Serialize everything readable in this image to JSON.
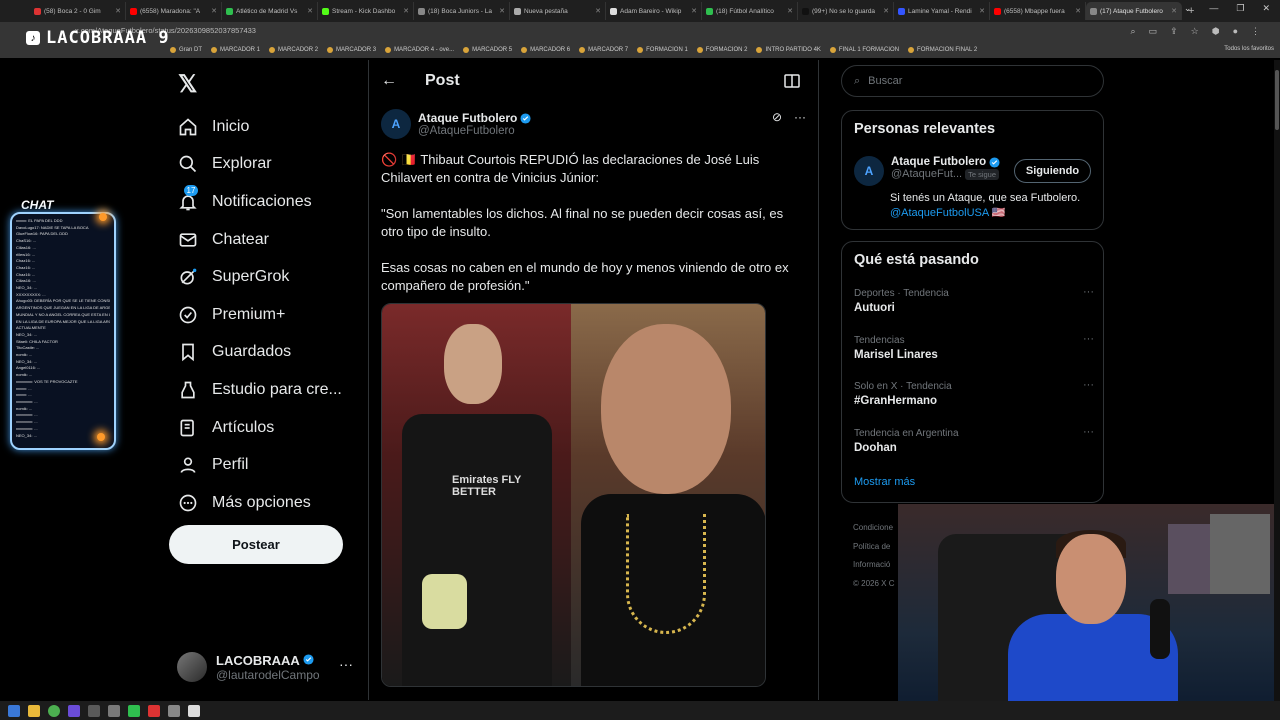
{
  "browser": {
    "tabs": [
      {
        "label": "(58) Boca 2 - 0 Gim",
        "color": "#d33"
      },
      {
        "label": "(6558) Maradona: \"A",
        "color": "#f00"
      },
      {
        "label": "Atlético de Madrid Vs",
        "color": "#2fbf4f"
      },
      {
        "label": "Stream - Kick Dashbo",
        "color": "#53fc18"
      },
      {
        "label": "(18) Boca Juniors - La",
        "color": "#888"
      },
      {
        "label": "Nueva pestaña",
        "color": "#aaa"
      },
      {
        "label": "Adam Bareiro - Wikip",
        "color": "#ddd"
      },
      {
        "label": "(18) Fútbol Analítico",
        "color": "#2fbf4f"
      },
      {
        "label": "(99+) No se lo guarda",
        "color": "#111"
      },
      {
        "label": "Lamine Yamal - Rendi",
        "color": "#3355ff"
      },
      {
        "label": "(6558) Mbappe fuera",
        "color": "#f00"
      },
      {
        "label": "(17) Ataque Futbolero",
        "color": "#888"
      }
    ],
    "url": "x.com/AtaqueFutbolero/status/2026309852037857433",
    "bookmarks": [
      "Gran DT",
      "MARCADOR 1",
      "MARCADOR 2",
      "MARCADOR 3",
      "MARCADOR 4 - ove...",
      "MARCADOR 5",
      "MARCADOR 6",
      "MARCADOR 7",
      "FORMACION 1",
      "FORMACION 2",
      "INTRO PARTIDO 4K",
      "FINAL 1 FORMACION",
      "FORMACION FINAL 2"
    ],
    "bookmarks_right": "Todos los favoritos"
  },
  "overlay": {
    "logo_text": "LACOBRAAA 9",
    "chat_label": "CHAT",
    "chat_lines": [
      "xxxxx: EL PAPA DEL DDD",
      "DavoLugo17: NADIE SE TAPA LA BOCA",
      "GlueFlow16: PAPA DEL DDD",
      "ChaS16: ...",
      "Cilias16: ...",
      "riilew16: ...",
      "Chaz16: ...",
      "Chaz16: ...",
      "Chaz16: ...",
      "Cilias16: ...",
      "NEO_34: ...",
      "XXXXXXXXX: ...",
      "Ahugo03: DEBERÍA POR QUE SE LE TIENE CONSIDERACIÓN A",
      "ARGENTINOS QUE JUEGAN EN LA LIGA DE ARGENTINA PARA EL",
      "MUNDIAL Y NO A ANGEL CORREA QUE ESTA EN UN BUEN NIVEL",
      "EN LA LIGA DE EUROPA MEJOR QUE LA LIGA ARGENTINA",
      "ACTUALMENTE",
      "NEO_34: ...",
      "Sitaeli: CHILA FACTOR",
      "TitoCastle: ...",
      "nomik: ...",
      "NEO_34: ...",
      "Angel0116: ...",
      "nomik: ...",
      "xxxxxxxx: VOS TE PROVOCAZTE",
      "xxxxx: ...",
      "xxxxx: ...",
      "xxxxxxxx: ...",
      "nomik: ...",
      "xxxxxxxx: ...",
      "xxxxxxxx: ...",
      "xxxxxxxx: ...",
      "NEO_34: ..."
    ]
  },
  "sidebar": {
    "items": [
      {
        "label": "Inicio",
        "icon": "home-icon"
      },
      {
        "label": "Explorar",
        "icon": "search-icon"
      },
      {
        "label": "Notificaciones",
        "icon": "bell-icon"
      },
      {
        "label": "Chatear",
        "icon": "mail-icon"
      },
      {
        "label": "SuperGrok",
        "icon": "grok-icon"
      },
      {
        "label": "Premium+",
        "icon": "premium-icon"
      },
      {
        "label": "Guardados",
        "icon": "bookmark-icon"
      },
      {
        "label": "Estudio para cre...",
        "icon": "studio-icon"
      },
      {
        "label": "Artículos",
        "icon": "article-icon"
      },
      {
        "label": "Perfil",
        "icon": "person-icon"
      },
      {
        "label": "Más opciones",
        "icon": "more-circle-icon"
      }
    ],
    "notifications_badge": "17",
    "post_button": "Postear",
    "profile": {
      "name": "LACOBRAAA",
      "handle": "@lautarodelCampo"
    }
  },
  "post": {
    "header_title": "Post",
    "author_name": "Ataque Futbolero",
    "author_handle": "@AtaqueFutbolero",
    "avatar_text": "A",
    "paragraphs": [
      "🚫 🇧🇪 Thibaut Courtois REPUDIÓ las declaraciones de José Luis Chilavert en contra de Vinicius Júnior:",
      "\"Son lamentables los dichos. Al final no se pueden decir cosas así, es otro tipo de insulto.",
      "Esas cosas no caben en el mundo de hoy y menos viniendo de otro ex compañero de profesión.\""
    ],
    "image_jersey_text": "Emirates FLY BETTER"
  },
  "right": {
    "search_placeholder": "Buscar",
    "relevant_title": "Personas relevantes",
    "relevant": {
      "name": "Ataque Futbolero",
      "handle": "@AtaqueFut...",
      "follows_you": "Te sigue",
      "button": "Siguiendo",
      "bio": "Si tenés un Ataque, que sea Futbolero.",
      "bio_link": "@AtaqueFutbolUSA 🇺🇸"
    },
    "trending_title": "Qué está pasando",
    "trends": [
      {
        "context": "Deportes · Tendencia",
        "title": "Autuori"
      },
      {
        "context": "Tendencias",
        "title": "Marisel Linares"
      },
      {
        "context": "Solo en X · Tendencia",
        "title": "#GranHermano"
      },
      {
        "context": "Tendencia en Argentina",
        "title": "Doohan"
      }
    ],
    "show_more": "Mostrar más",
    "footer": [
      "Condicione",
      "Política de",
      "Informació",
      "© 2026 X C"
    ]
  }
}
